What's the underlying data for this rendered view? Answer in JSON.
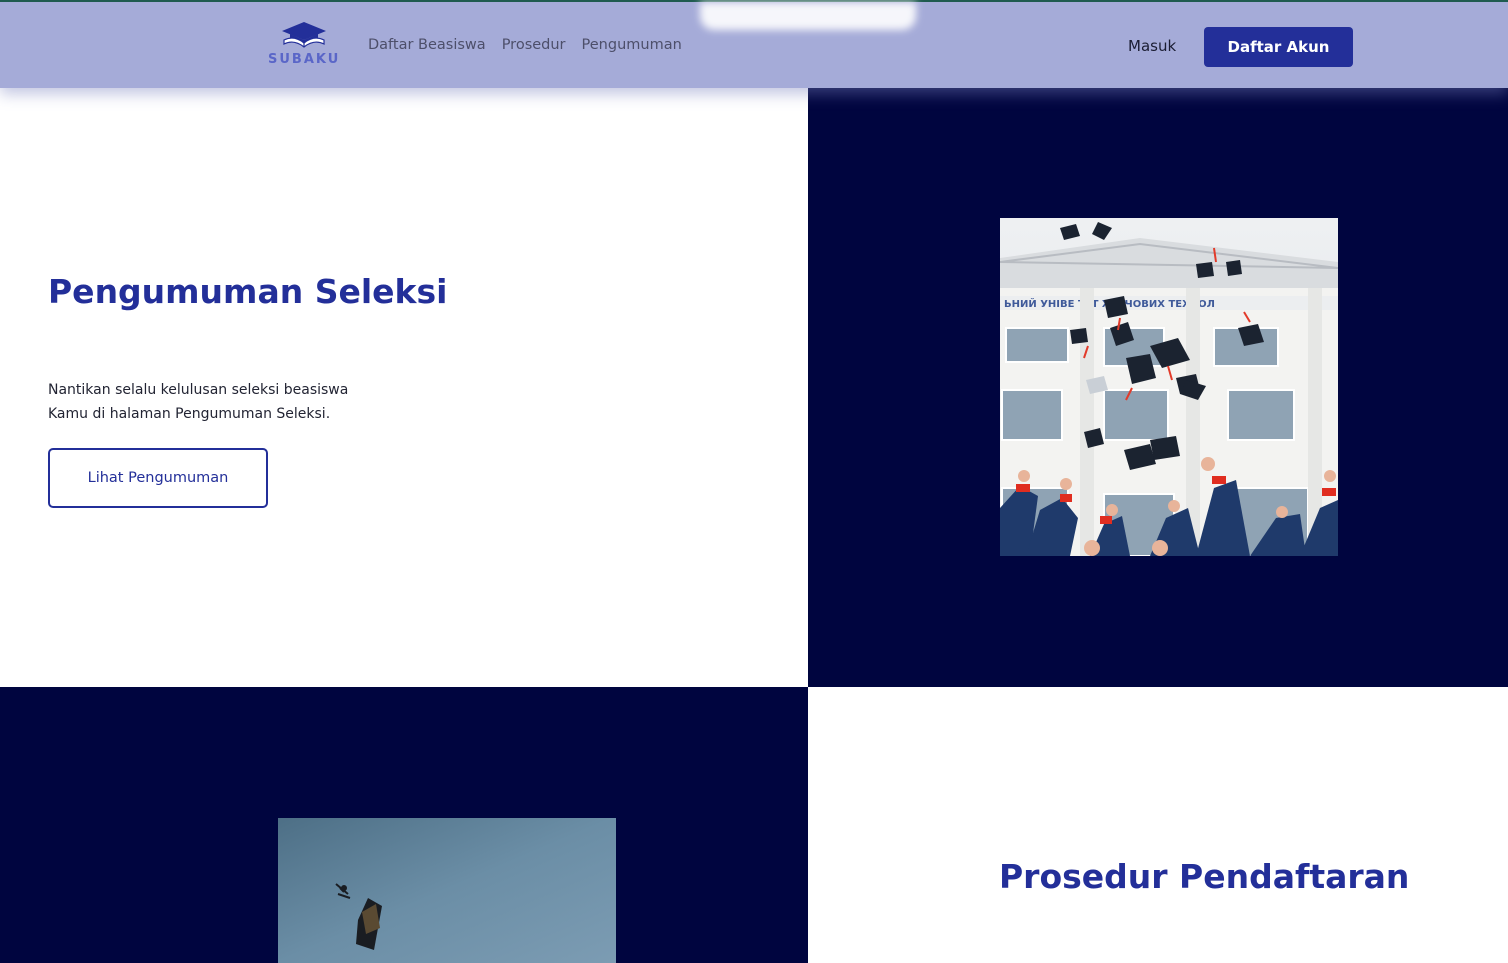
{
  "navbar": {
    "logo_text": "SUBAKU",
    "links": [
      "Daftar Beasiswa",
      "Prosedur",
      "Pengumuman"
    ],
    "login_label": "Masuk",
    "register_label": "Daftar Akun"
  },
  "announcement_section": {
    "title": "Pengumuman Seleksi",
    "description": "Nantikan selalu kelulusan seleksi beasiswa Kamu di halaman Pengumuman Seleksi.",
    "button_label": "Lihat Pengumuman"
  },
  "procedure_section": {
    "title": "Prosedur Pendaftaran"
  },
  "colors": {
    "navbar_bg": "#a5abd8",
    "primary": "#232f99",
    "dark_navy": "#00053f",
    "white": "#ffffff"
  },
  "icons": {
    "logo": "graduation-cap-book-icon",
    "photo1": "graduation-caps-thrown-photo",
    "photo2": "graduation-cap-sky-photo"
  }
}
